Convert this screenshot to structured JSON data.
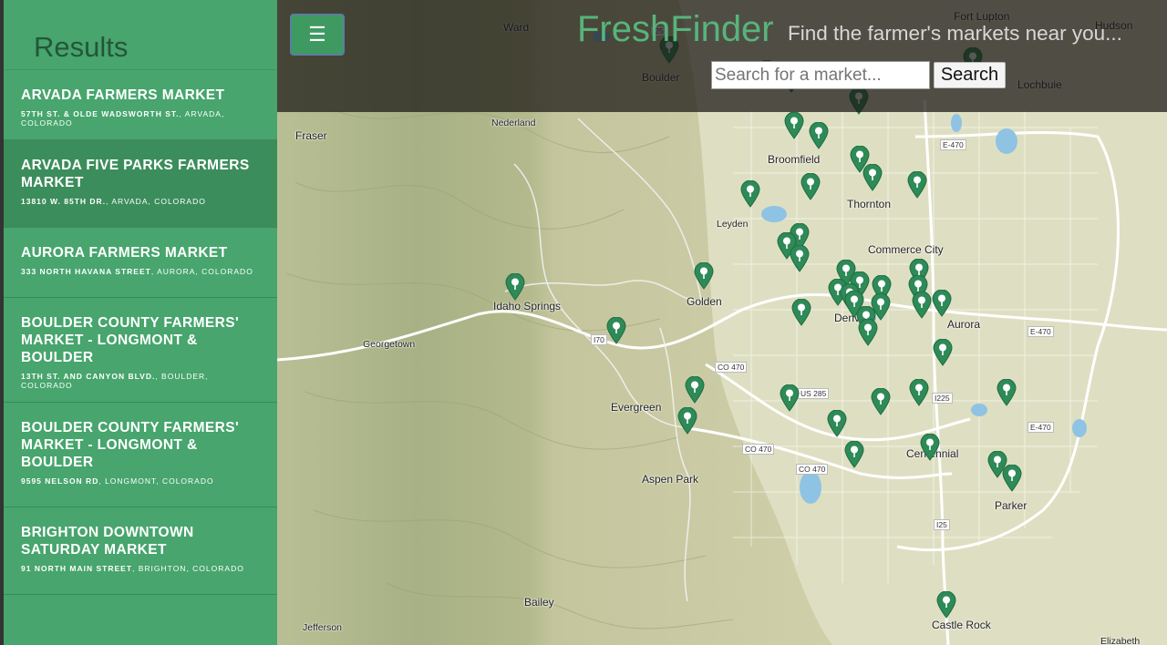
{
  "sidebar": {
    "title": "Results",
    "results": [
      {
        "name": "ARVADA FARMERS MARKET",
        "street": "57TH ST. & OLDE WADSWORTH ST.",
        "city_state": ", ARVADA, COLORADO",
        "active": false
      },
      {
        "name": "ARVADA FIVE PARKS FARMERS MARKET",
        "street": "13810 W. 85TH DR.",
        "city_state": ", ARVADA, COLORADO",
        "active": true
      },
      {
        "name": "AURORA FARMERS MARKET",
        "street": "333 NORTH HAVANA STREET",
        "city_state": ", AURORA, COLORADO",
        "active": false
      },
      {
        "name": "BOULDER COUNTY FARMERS' MARKET - LONGMONT & BOULDER",
        "street": "13TH ST. AND CANYON BLVD.",
        "city_state": ", BOULDER, COLORADO",
        "active": false
      },
      {
        "name": "BOULDER COUNTY FARMERS' MARKET - LONGMONT & BOULDER",
        "street": "9595 NELSON RD",
        "city_state": ", LONGMONT, COLORADO",
        "active": false
      },
      {
        "name": "BRIGHTON DOWNTOWN SATURDAY MARKET",
        "street": "91 NORTH MAIN STREET",
        "city_state": ", BRIGHTON, COLORADO",
        "active": false
      }
    ]
  },
  "header": {
    "menu_icon": "hamburger-icon",
    "brand": "FreshFinder",
    "tagline": "Find the farmer's markets near you...",
    "search_placeholder": "Search for a market...",
    "search_label": "Search"
  },
  "map": {
    "places": [
      "Ward",
      "Boulder",
      "Fort Lupton",
      "Hudson",
      "Lochbuie",
      "Nederland",
      "Fraser",
      "Broomfield",
      "Thornton",
      "Leyden",
      "Commerce City",
      "Golden",
      "Idaho Springs",
      "Georgetown",
      "Aurora",
      "Evergreen",
      "Aspen Park",
      "Centennial",
      "Parker",
      "Bailey",
      "Jefferson",
      "Castle Rock",
      "Elizabeth",
      "Denver"
    ],
    "roads": [
      "I25",
      "E-470",
      "I70",
      "CO 470",
      "US 285",
      "I225",
      "E-470",
      "E-470",
      "CO 470",
      "CO 470",
      "I25"
    ],
    "marker_icon": "map-pin-icon",
    "colors": {
      "marker": "#2e8a57",
      "sidebar": "#47a56d",
      "brand": "#58b47c"
    }
  }
}
